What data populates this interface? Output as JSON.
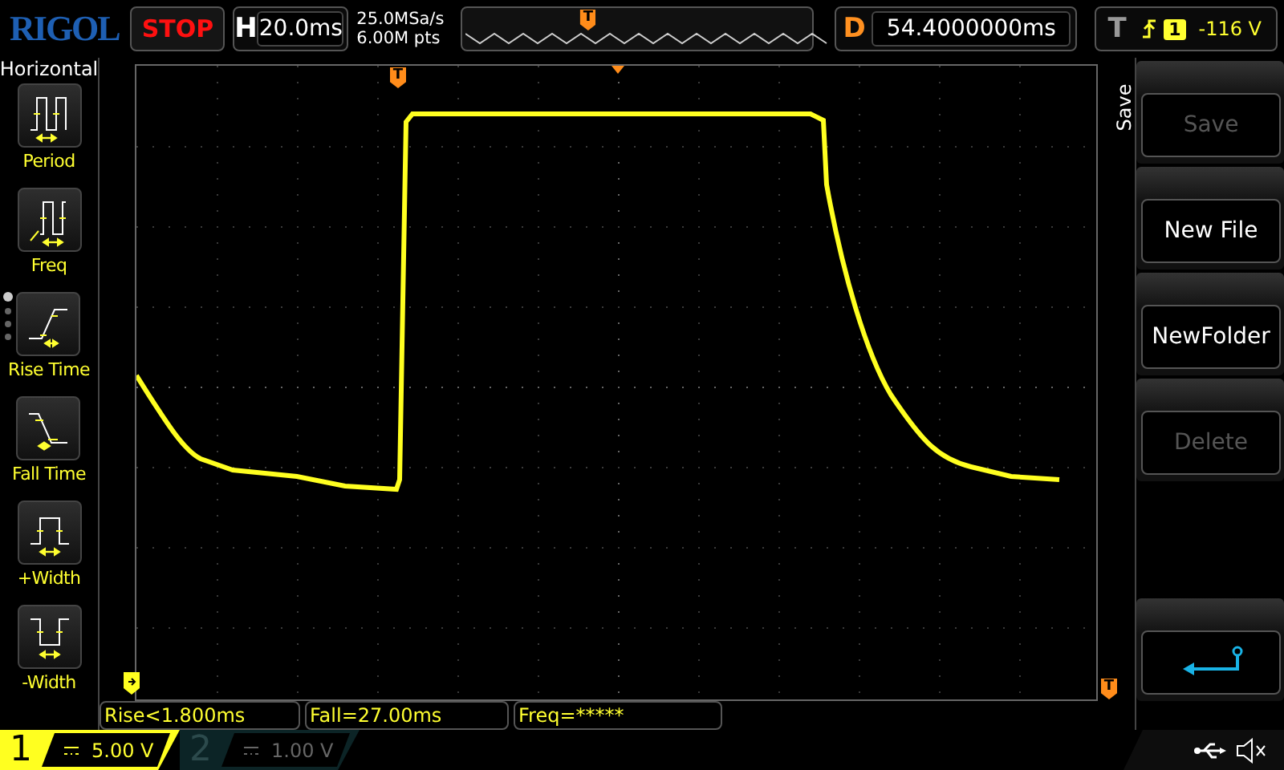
{
  "header": {
    "logo": "RIGOL",
    "run_status": "STOP",
    "timebase": {
      "label": "H",
      "value": "20.0ms"
    },
    "sample_rate": "25.0MSa/s",
    "memory_depth": "6.00M pts",
    "overview_marker": "T",
    "delay": {
      "label": "D",
      "value": "54.4000000ms"
    },
    "trigger": {
      "label": "T",
      "source": "1",
      "level": "-116 V"
    }
  },
  "left_menu": {
    "title": "Horizontal",
    "pages": [
      {
        "selected": true
      },
      {
        "selected": false
      },
      {
        "selected": false
      },
      {
        "selected": false
      }
    ],
    "items": [
      {
        "kind": "period",
        "label": "Period"
      },
      {
        "kind": "freq",
        "label": "Freq"
      },
      {
        "kind": "rise",
        "label": "Rise Time"
      },
      {
        "kind": "fall",
        "label": "Fall Time"
      },
      {
        "kind": "pwidth",
        "label": "+Width"
      },
      {
        "kind": "nwidth",
        "label": "-Width"
      }
    ]
  },
  "display": {
    "trigger_position_marker": "T",
    "trigger_level_marker": "T"
  },
  "measurements": [
    "Rise<1.800ms",
    "Fall=27.00ms",
    "Freq=*****"
  ],
  "right_menu": {
    "title": "Save",
    "buttons": [
      {
        "kind": "text",
        "label": "Save",
        "disabled": true
      },
      {
        "kind": "text",
        "label": "New File",
        "disabled": false
      },
      {
        "kind": "text",
        "label": "NewFolder",
        "disabled": false
      },
      {
        "kind": "text",
        "label": "Delete",
        "disabled": true
      },
      {
        "kind": "spacer"
      },
      {
        "kind": "back"
      }
    ]
  },
  "channels": [
    {
      "number": "1",
      "scale": "5.00 V",
      "on": true
    },
    {
      "number": "2",
      "scale": "1.00 V",
      "on": false
    }
  ]
}
